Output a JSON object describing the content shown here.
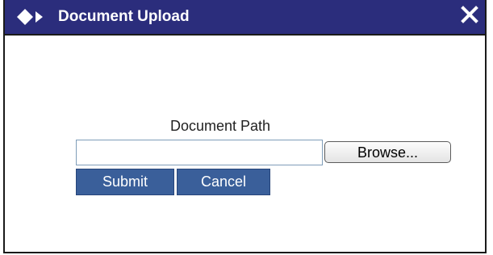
{
  "dialog": {
    "title": "Document Upload",
    "title_icon": "diamond-arrow-icon",
    "close_icon": "close-x-icon"
  },
  "form": {
    "path_label": "Document Path",
    "path_value": "",
    "path_placeholder": "",
    "browse_label": "Browse...",
    "submit_label": "Submit",
    "cancel_label": "Cancel"
  },
  "colors": {
    "titlebar": "#2b2d7c",
    "button": "#3a5f9a",
    "button_text": "#ffffff",
    "input_border": "#7f9db9"
  }
}
